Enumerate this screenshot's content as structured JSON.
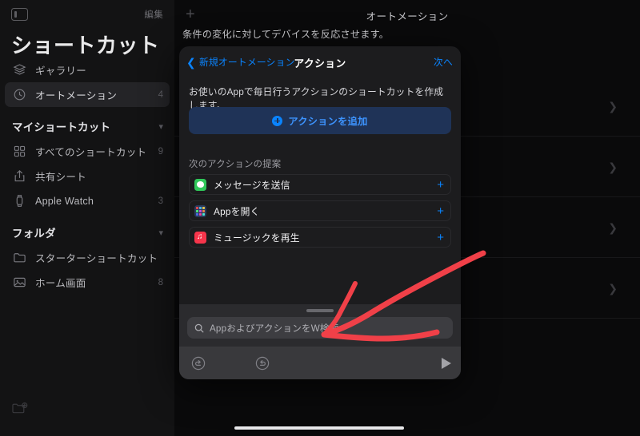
{
  "sidebar": {
    "toggle_icon": "sidebar-toggle-icon",
    "edit_label": "編集",
    "title": "ショートカット",
    "items": [
      {
        "icon": "gallery-stack-icon",
        "label": "ギャラリー",
        "count": "",
        "selected": false
      },
      {
        "icon": "automation-clock-icon",
        "label": "オートメーション",
        "count": "4",
        "selected": true
      }
    ],
    "groups": [
      {
        "label": "マイショートカット",
        "chevron": "chevron-down-icon",
        "items": [
          {
            "icon": "grid-squares-icon",
            "label": "すべてのショートカット",
            "count": "9"
          },
          {
            "icon": "share-sheet-icon",
            "label": "共有シート",
            "count": ""
          },
          {
            "icon": "apple-watch-icon",
            "label": "Apple Watch",
            "count": "3"
          }
        ]
      },
      {
        "label": "フォルダ",
        "chevron": "chevron-down-icon",
        "items": [
          {
            "icon": "folder-icon",
            "label": "スターターショートカット",
            "count": ""
          },
          {
            "icon": "photo-icon",
            "label": "ホーム画面",
            "count": "8"
          }
        ]
      }
    ],
    "new_folder_icon": "new-folder-icon"
  },
  "main": {
    "add_icon": "plus-icon",
    "title": "オートメーション",
    "subtitle": "条件の変化に対してデバイスを反応させます。",
    "background_rows": [
      {
        "chevron": "chevron-right-icon"
      },
      {
        "chevron": "chevron-right-icon"
      },
      {
        "chevron": "chevron-right-icon"
      },
      {
        "chevron": "chevron-right-icon"
      }
    ]
  },
  "sheet": {
    "back_label": "新規オートメーション",
    "back_icon": "chevron-left-icon",
    "title": "アクション",
    "next_label": "次へ",
    "description": "お使いのAppで毎日行うアクションのショートカットを作成します。",
    "add_action_label": "アクションを追加",
    "add_action_icon": "plus-circle-icon",
    "suggestions_header": "次のアクションの提案",
    "suggestions": [
      {
        "app_icon": "messages-app-icon",
        "label": "メッセージを送信",
        "add_icon": "plus-icon"
      },
      {
        "app_icon": "app-grid-icon",
        "label": "Appを開く",
        "add_icon": "plus-icon"
      },
      {
        "app_icon": "music-app-icon",
        "label": "ミュージックを再生",
        "add_icon": "plus-icon"
      }
    ],
    "search": {
      "icon": "search-icon",
      "placeholder": "AppおよびアクションをW検索",
      "value": ""
    },
    "toolbar": {
      "undo_icon": "undo-icon",
      "redo_icon": "redo-icon",
      "play_icon": "play-icon"
    },
    "grabber": "drag-handle"
  },
  "annotation": {
    "color": "#f04048",
    "description": "hand-drawn-arrow-pointing-to-search-field"
  },
  "home_indicator": "home-indicator",
  "colors": {
    "accent_blue": "#0a84ff",
    "sheet_bg": "#1c1c1e",
    "sidebar_bg": "#131314",
    "annotation_red": "#f04048"
  }
}
